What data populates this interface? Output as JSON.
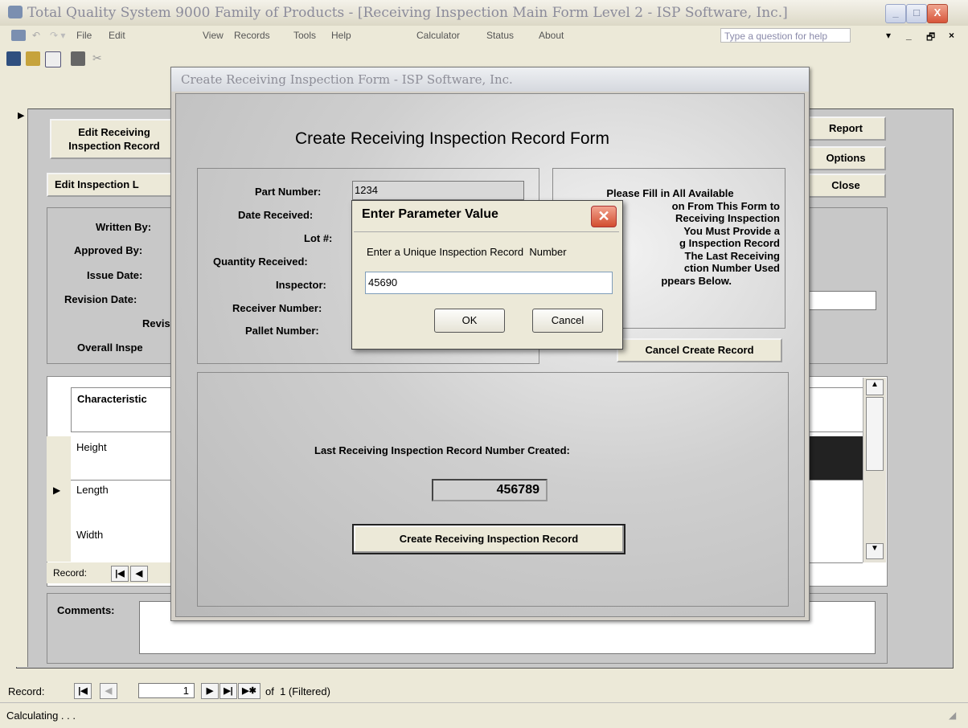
{
  "window": {
    "title": "Total Quality System 9000 Family of Products - [Receiving Inspection Main Form Level 2 - ISP Software, Inc.]",
    "minimize": "_",
    "restore": "□",
    "close": "X"
  },
  "menu": {
    "items": [
      "File",
      "Edit",
      "View",
      "Records",
      "Tools",
      "Help",
      "Calculator",
      "Status",
      "About"
    ],
    "question_placeholder": "Type a question for help",
    "doc_controls": [
      "▾",
      "_",
      "🗗",
      "×"
    ]
  },
  "main_form": {
    "buttons": {
      "edit_receiving": "Edit Receiving Inspection Record",
      "edit_inspection": "Edit Inspection L",
      "report": "Report",
      "options": "Options",
      "close": "Close"
    },
    "labels": {
      "written_by": "Written By:",
      "approved_by": "Approved By:",
      "issue_date": "Issue Date:",
      "revision_date": "Revision Date:",
      "revis": "Revis",
      "overall": "Overall Inspe",
      "characteristic": "Characteristic",
      "comments": "Comments:"
    },
    "grid_rows": [
      "Height",
      "Length",
      "Width"
    ],
    "subform_record_label": "Record:"
  },
  "record_nav": {
    "label": "Record:",
    "current": "1",
    "total_text": "of  1 (Filtered)"
  },
  "status": {
    "text": "Calculating . . ."
  },
  "modal": {
    "title": "Create Receiving Inspection Form - ISP Software, Inc.",
    "heading": "Create Receiving Inspection Record Form",
    "fields": [
      {
        "label": "Part Number:",
        "value": "1234"
      },
      {
        "label": "Date Received:",
        "value": ""
      },
      {
        "label": "Lot #:",
        "value": ""
      },
      {
        "label": "Quantity Received:",
        "value": ""
      },
      {
        "label": "Inspector:",
        "value": ""
      },
      {
        "label": "Receiver Number:",
        "value": ""
      },
      {
        "label": "Pallet Number:",
        "value": ""
      }
    ],
    "instructions": [
      "Please Fill in All Available",
      "on From This Form to",
      "Receiving Inspection",
      "You Must Provide a",
      "g Inspection Record",
      "The Last Receiving",
      "ction Number Used",
      "ppears Below."
    ],
    "cancel_button": "Cancel Create Record",
    "last_label": "Last Receiving Inspection Record Number Created:",
    "last_number": "456789",
    "create_button": "Create Receiving Inspection Record"
  },
  "dialog": {
    "title": "Enter Parameter Value",
    "prompt": "Enter a Unique Inspection Record  Number",
    "value": "45690",
    "ok": "OK",
    "cancel": "Cancel"
  }
}
